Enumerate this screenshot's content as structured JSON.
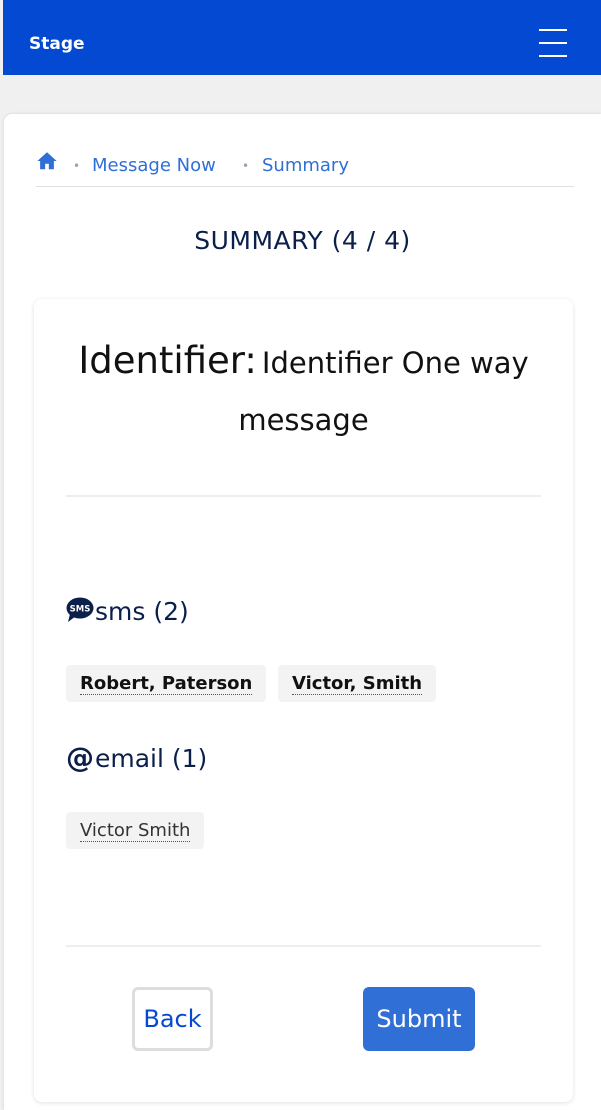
{
  "header": {
    "brand": "Stage",
    "menu_icon": "hamburger-menu-icon",
    "background": "#0449d1"
  },
  "breadcrumb": {
    "home_icon": "home-icon",
    "items": [
      "Message Now",
      "Summary"
    ],
    "separator": "•"
  },
  "page": {
    "title": "SUMMARY (4 / 4)"
  },
  "summary": {
    "identifier_label": "Identifier:",
    "identifier_value": "Identifier One way message",
    "sms": {
      "icon": "sms-icon",
      "heading": "sms (2)",
      "recipients": [
        "Robert, Paterson",
        "Victor, Smith"
      ]
    },
    "email": {
      "icon": "at-sign-icon",
      "icon_glyph": "@",
      "heading": "email (1)",
      "recipients": [
        "Victor Smith"
      ]
    }
  },
  "actions": {
    "back_label": "Back",
    "submit_label": "Submit",
    "primary_color": "#2f6fd6"
  }
}
